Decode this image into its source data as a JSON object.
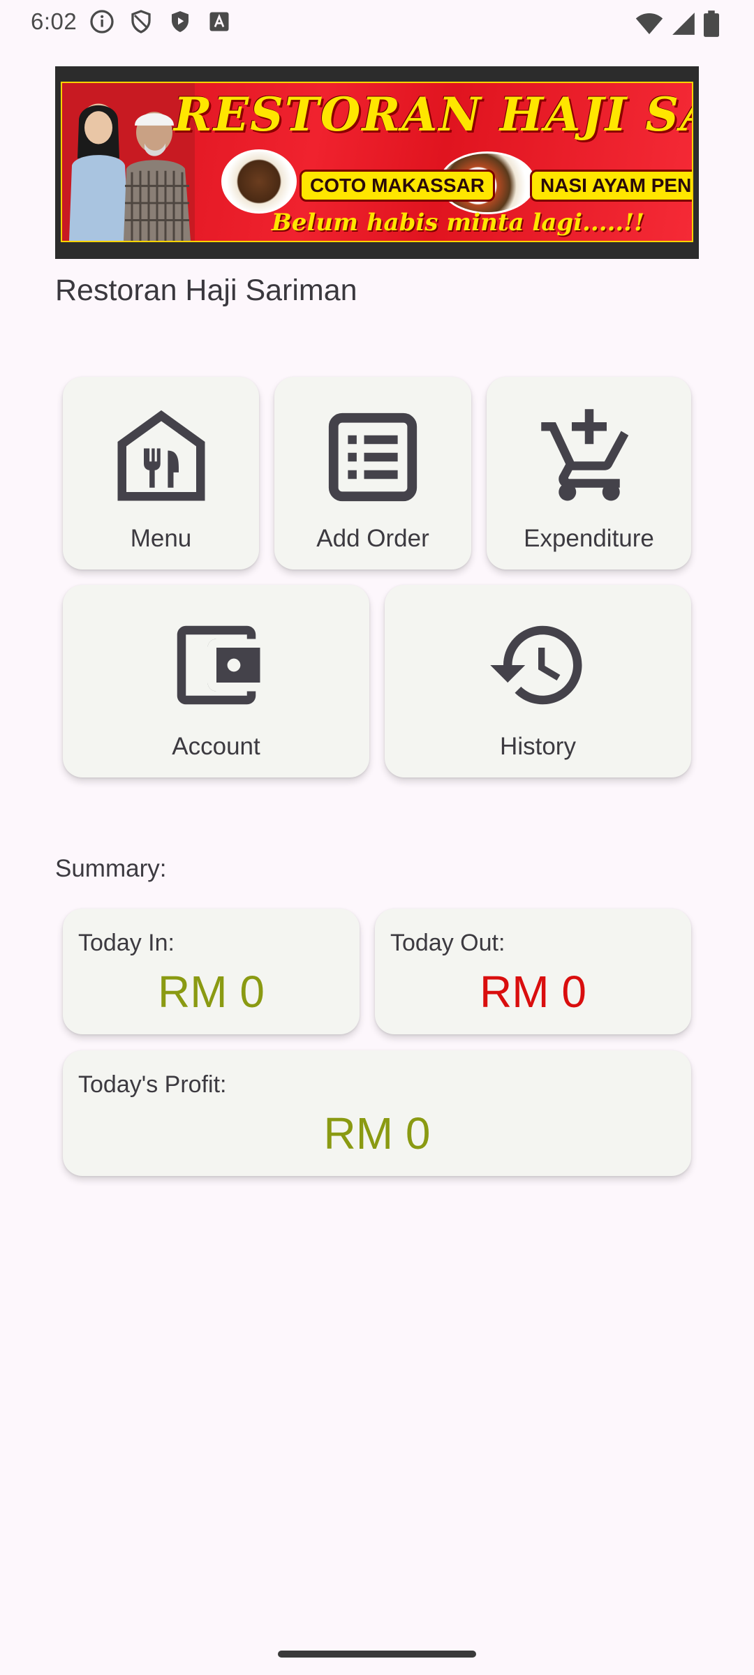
{
  "status_bar": {
    "time": "6:02",
    "icons": [
      "info-icon",
      "shield-icon",
      "play-protect-icon",
      "keyboard-a-icon",
      "wifi-icon",
      "cellular-signal-icon",
      "battery-icon"
    ]
  },
  "banner": {
    "title": "RESTORAN HAJI SARIMAN",
    "dish_1": "COTO MAKASSAR",
    "dish_2": "NASI AYAM PENYET",
    "slogan": "Belum habis minta lagi.....!!"
  },
  "app": {
    "title": "Restoran Haji Sariman"
  },
  "tiles": {
    "menu": "Menu",
    "add_order": "Add Order",
    "expenditure": "Expenditure",
    "account": "Account",
    "history": "History"
  },
  "summary": {
    "label": "Summary:",
    "today_in": {
      "label": "Today In:",
      "value": "RM 0",
      "color": "#8a9a12"
    },
    "today_out": {
      "label": "Today Out:",
      "value": "RM 0",
      "color": "#d90e0e"
    },
    "today_profit": {
      "label": "Today's Profit:",
      "value": "RM 0",
      "color": "#8a9a12"
    }
  },
  "colors": {
    "background": "#fdf7fc",
    "tile": "#f4f5f1",
    "icon": "#44424a"
  }
}
